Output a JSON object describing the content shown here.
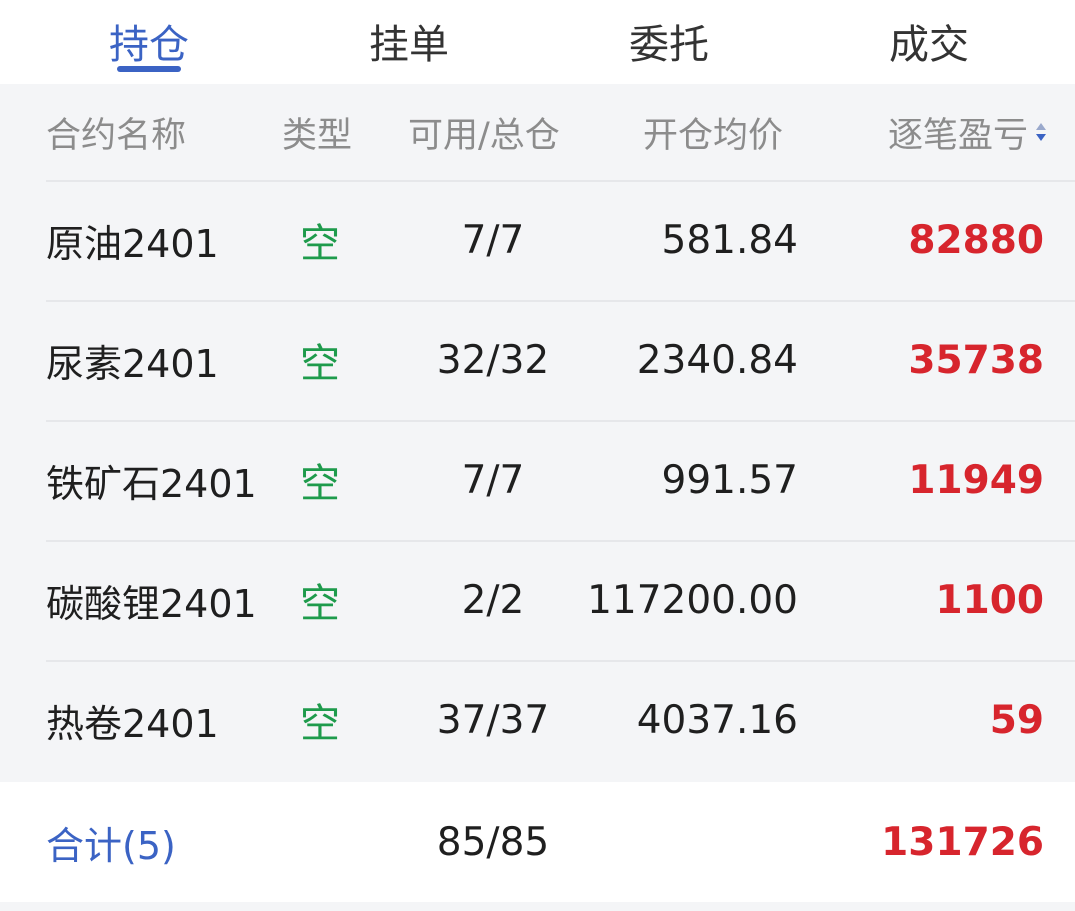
{
  "tabs": [
    {
      "label": "持仓",
      "active": true
    },
    {
      "label": "挂单",
      "active": false
    },
    {
      "label": "委托",
      "active": false
    },
    {
      "label": "成交",
      "active": false
    }
  ],
  "table": {
    "headers": {
      "name": "合约名称",
      "type": "类型",
      "position": "可用/总仓",
      "avg_price": "开仓均价",
      "pnl": "逐笔盈亏"
    },
    "sort_icon": "sort-arrows-icon",
    "rows": [
      {
        "name": "原油2401",
        "type": "空",
        "position": "7/7",
        "avg_price": "581.84",
        "pnl": "82880"
      },
      {
        "name": "尿素2401",
        "type": "空",
        "position": "32/32",
        "avg_price": "2340.84",
        "pnl": "35738"
      },
      {
        "name": "铁矿石2401",
        "type": "空",
        "position": "7/7",
        "avg_price": "991.57",
        "pnl": "11949"
      },
      {
        "name": "碳酸锂2401",
        "type": "空",
        "position": "2/2",
        "avg_price": "117200.00",
        "pnl": "1100"
      },
      {
        "name": "热卷2401",
        "type": "空",
        "position": "37/37",
        "avg_price": "4037.16",
        "pnl": "59"
      }
    ]
  },
  "footer": {
    "label": "合计(5)",
    "position": "85/85",
    "pnl": "131726"
  },
  "colors": {
    "accent": "#3b63c4",
    "short_type": "#1e9b4c",
    "profit": "#d7252d",
    "header_text": "#8c8c8c",
    "background": "#f4f5f7"
  }
}
